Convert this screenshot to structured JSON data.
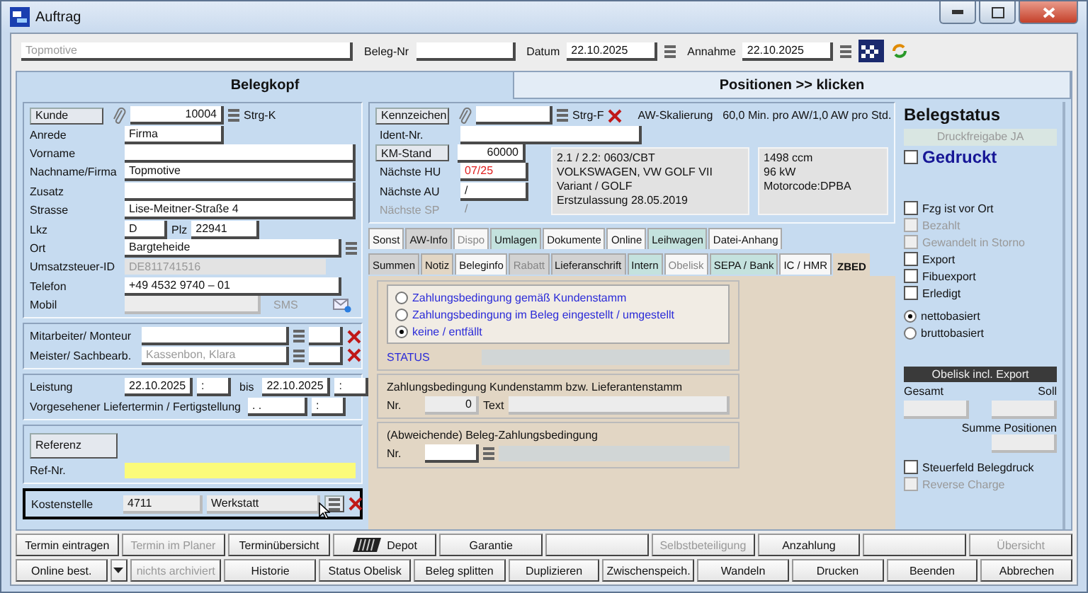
{
  "window": {
    "title": "Auftrag"
  },
  "header": {
    "company": "Topmotive",
    "beleg_nr_label": "Beleg-Nr",
    "datum_label": "Datum",
    "datum": "22.10.2025",
    "annahme_label": "Annahme",
    "annahme": "22.10.2025"
  },
  "main_tabs": [
    {
      "label": "Belegkopf",
      "selected": true
    },
    {
      "label": "Positionen >> klicken",
      "selected": false
    }
  ],
  "customer": {
    "kunde_button": "Kunde",
    "kunde_nr": "10004",
    "shortcut": "Strg-K",
    "rows": [
      {
        "kind": "short",
        "label": "Anrede",
        "value": "Firma"
      },
      {
        "kind": "full",
        "label": "Vorname"
      },
      {
        "kind": "full",
        "label": "Nachname/Firma",
        "value": "Topmotive"
      },
      {
        "kind": "full",
        "label": "Zusatz"
      },
      {
        "kind": "full",
        "label": "Strasse",
        "value": "Lise-Meitner-Straße 4"
      },
      {
        "kind": "lkz",
        "label": "Lkz",
        "value": "D",
        "plz_label": "Plz",
        "plz": "22941"
      },
      {
        "kind": "lookup",
        "label": "Ort",
        "value": "Bargteheide"
      },
      {
        "kind": "readonly",
        "label": "Umsatzsteuer-ID",
        "value": "DE811741516"
      },
      {
        "kind": "phone",
        "label": "Telefon",
        "value": "+49 4532 9740 – 01"
      },
      {
        "kind": "mobile",
        "label": "Mobil",
        "sms": "SMS"
      }
    ]
  },
  "staff": [
    {
      "label": "Mitarbeiter/ Monteur"
    },
    {
      "label": "Meister/ Sachbearb.",
      "placeholder": "Kassenbon, Klara"
    }
  ],
  "dates": {
    "leistung_label": "Leistung",
    "from": "22.10.2025",
    "from_time": ":",
    "bis_label": "bis",
    "to": "22.10.2025",
    "to_time": ":",
    "liefer_label": "Vorgesehener Liefertermin / Fertigstellung",
    "liefer_date": ". .",
    "liefer_time": ":"
  },
  "reference": {
    "button": "Referenz",
    "ref_label": "Ref-Nr."
  },
  "kostenstelle": {
    "label": "Kostenstelle",
    "nr": "4711",
    "name": "Werkstatt"
  },
  "vehicle": {
    "kennzeichen_button": "Kennzeichen",
    "shortcut": "Strg-F",
    "aw_label": "AW-Skalierung",
    "aw_value": "60,0 Min. pro AW/1,0 AW pro Std.",
    "ident_label": "Ident-Nr.",
    "km_button": "KM-Stand",
    "km": "60000",
    "dues": [
      {
        "label": "Nächste HU",
        "value": "07/25",
        "overdue": true,
        "disabled": false
      },
      {
        "label": "Nächste AU",
        "value": "/",
        "overdue": false,
        "disabled": false
      },
      {
        "label": "Nächste SP",
        "value": "/",
        "overdue": false,
        "disabled": true
      }
    ],
    "info_left": [
      "2.1 / 2.2: 0603/CBT",
      "VOLKSWAGEN, VW GOLF VII",
      "Variant / GOLF",
      "Erstzulassung 28.05.2019"
    ],
    "info_right": [
      "1498 ccm",
      "96 kW",
      "Motorcode:DPBA"
    ]
  },
  "tabs_row1": [
    {
      "label": "Sonst",
      "color": "#f7f7f7",
      "disabled": false,
      "selected": false
    },
    {
      "label": "AW-Info",
      "color": "#d2d2d2",
      "disabled": false,
      "selected": false
    },
    {
      "label": "Dispo",
      "color": "#f7f7f7",
      "disabled": true,
      "selected": false
    },
    {
      "label": "Umlagen",
      "color": "#c4e2de",
      "disabled": false,
      "selected": false
    },
    {
      "label": "Dokumente",
      "color": "#f7f7f7",
      "disabled": false,
      "selected": false
    },
    {
      "label": "Online",
      "color": "#f7f7f7",
      "disabled": false,
      "selected": false
    },
    {
      "label": "Leihwagen",
      "color": "#c4e2de",
      "disabled": false,
      "selected": false
    },
    {
      "label": "Datei-Anhang",
      "color": "#f7f7f7",
      "disabled": false,
      "selected": false
    }
  ],
  "tabs_row2": [
    {
      "label": "Summen",
      "color": "#d2d2d2",
      "disabled": false,
      "selected": false
    },
    {
      "label": "Notiz",
      "color": "#e2d6c4",
      "disabled": false,
      "selected": false
    },
    {
      "label": "Beleginfo",
      "color": "#f7f7f7",
      "disabled": false,
      "selected": false
    },
    {
      "label": "Rabatt",
      "color": "#d2d2d2",
      "disabled": true,
      "selected": false
    },
    {
      "label": "Lieferanschrift",
      "color": "#d2d2d2",
      "disabled": false,
      "selected": false
    },
    {
      "label": "Intern",
      "color": "#c4e2de",
      "disabled": false,
      "selected": false
    },
    {
      "label": "Obelisk",
      "color": "#f7f7f7",
      "disabled": true,
      "selected": false
    },
    {
      "label": "SEPA / Bank",
      "color": "#c4e2de",
      "disabled": false,
      "selected": false
    },
    {
      "label": "IC / HMR",
      "color": "#f7f7f7",
      "disabled": false,
      "selected": false
    },
    {
      "label": "ZBED",
      "color": "#e2d6c4",
      "disabled": false,
      "selected": true
    }
  ],
  "zbed": {
    "options": [
      {
        "label": "Zahlungsbedingung gemäß Kundenstamm",
        "selected": false
      },
      {
        "label": "Zahlungsbedingung im Beleg eingestellt / umgestellt",
        "selected": false
      },
      {
        "label": "keine / entfällt",
        "selected": true
      }
    ],
    "status_label": "STATUS",
    "kunden_title": "Zahlungsbedingung Kundenstamm bzw. Lieferantenstamm",
    "kunden_nr_label": "Nr.",
    "kunden_nr": "0",
    "text_label": "Text",
    "beleg_title": "(Abweichende) Beleg-Zahlungsbedingung",
    "beleg_nr_label": "Nr."
  },
  "status": {
    "title": "Belegstatus",
    "release": "Druckfreigabe JA",
    "printed": {
      "label": "Gedruckt",
      "checked": false
    },
    "checks": [
      {
        "label": "Fzg ist vor Ort",
        "checked": false,
        "disabled": false
      },
      {
        "label": "Bezahlt",
        "checked": false,
        "disabled": true
      },
      {
        "label": "Gewandelt in Storno",
        "checked": false,
        "disabled": true
      },
      {
        "label": "Export",
        "checked": false,
        "disabled": false
      },
      {
        "label": "Fibuexport",
        "checked": false,
        "disabled": false
      },
      {
        "label": "Erledigt",
        "checked": false,
        "disabled": false
      }
    ],
    "basis": [
      {
        "label": "nettobasiert",
        "selected": true
      },
      {
        "label": "bruttobasiert",
        "selected": false
      }
    ],
    "obelisk": "Obelisk incl. Export",
    "gesamt": "Gesamt",
    "soll": "Soll",
    "summe": "Summe Positionen",
    "bottom_checks": [
      {
        "label": "Steuerfeld Belegdruck",
        "checked": false,
        "disabled": false
      },
      {
        "label": "Reverse Charge",
        "checked": false,
        "disabled": true
      }
    ]
  },
  "buttons_row1": [
    {
      "kind": "text",
      "label": "Termin eintragen",
      "disabled": false
    },
    {
      "kind": "text",
      "label": "Termin im Planer",
      "disabled": true
    },
    {
      "kind": "text",
      "label": "Terminübersicht",
      "disabled": false
    },
    {
      "kind": "depot",
      "label": "Depot",
      "disabled": false
    },
    {
      "kind": "text",
      "label": "Garantie",
      "disabled": false
    },
    {
      "kind": "blank"
    },
    {
      "kind": "text",
      "label": "Selbstbeteiligung",
      "disabled": true
    },
    {
      "kind": "text",
      "label": "Anzahlung",
      "disabled": false
    },
    {
      "kind": "blank"
    },
    {
      "kind": "text",
      "label": "Übersicht",
      "disabled": true
    }
  ],
  "buttons_row2": [
    {
      "kind": "dropdown",
      "label": "Online best.",
      "disabled": false
    },
    {
      "kind": "text",
      "label": "nichts archiviert",
      "disabled": true
    },
    {
      "kind": "text",
      "label": "Historie",
      "disabled": false
    },
    {
      "kind": "text",
      "label": "Status Obelisk",
      "disabled": false
    },
    {
      "kind": "text",
      "label": "Beleg splitten",
      "disabled": false
    },
    {
      "kind": "text",
      "label": "Duplizieren",
      "disabled": false
    },
    {
      "kind": "text",
      "label": "Zwischenspeich.",
      "disabled": false
    },
    {
      "kind": "text",
      "label": "Wandeln",
      "disabled": false
    },
    {
      "kind": "text",
      "label": "Drucken",
      "disabled": false
    },
    {
      "kind": "text",
      "label": "Beenden",
      "disabled": false
    },
    {
      "kind": "text",
      "label": "Abbrechen",
      "disabled": false
    }
  ]
}
